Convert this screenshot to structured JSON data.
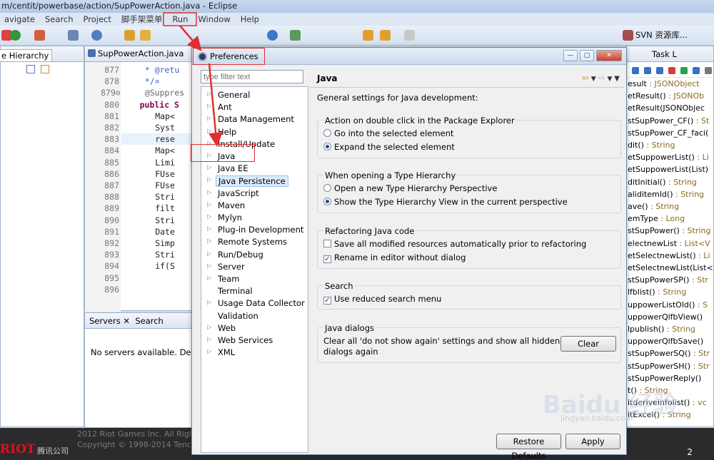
{
  "window": {
    "title": "m/centit/powerbase/action/SupPowerAction.java - Eclipse"
  },
  "menu": [
    "avigate",
    "Search",
    "Project",
    "脚手架菜单",
    "Run",
    "Window",
    "Help"
  ],
  "toolbar": {
    "svn_label": "SVN 资源库..."
  },
  "hierarchy": {
    "tab": "e Hierarchy"
  },
  "editor": {
    "tab": "SupPowerAction.java",
    "lines": [
      {
        "n": "877",
        "code": "* @retu"
      },
      {
        "n": "878",
        "code": "*/¤"
      },
      {
        "n": "879⊖",
        "code": "@Suppres"
      },
      {
        "n": "880",
        "code": "public S"
      },
      {
        "n": "881",
        "code": "Map<"
      },
      {
        "n": "882",
        "code": "Syst"
      },
      {
        "n": "883",
        "code": "rese"
      },
      {
        "n": "884",
        "code": "Map<"
      },
      {
        "n": "885",
        "code": "Limi"
      },
      {
        "n": "886",
        "code": "FUse"
      },
      {
        "n": "887",
        "code": "FUse"
      },
      {
        "n": "888",
        "code": "Stri"
      },
      {
        "n": "889",
        "code": "filt"
      },
      {
        "n": "890",
        "code": "Stri"
      },
      {
        "n": "891",
        "code": "Date"
      },
      {
        "n": "892",
        "code": "Simp"
      },
      {
        "n": "893",
        "code": "Stri"
      },
      {
        "n": "894",
        "code": "if(S"
      },
      {
        "n": "895",
        "code": ""
      },
      {
        "n": "896",
        "code": ""
      }
    ]
  },
  "servers": {
    "tab1": "Servers",
    "tab2": "Search",
    "message": "No servers available. Define"
  },
  "outline": {
    "tab": "Task L",
    "items": [
      {
        "name": "esult",
        "type": " : JSONObject"
      },
      {
        "name": "etResult()",
        "type": " : JSONOb"
      },
      {
        "name": "etResult(JSONObjec",
        "type": ""
      },
      {
        "name": "stSupPower_CF()",
        "type": " : St"
      },
      {
        "name": "stSupPower_CF_faci(",
        "type": ""
      },
      {
        "name": "dit()",
        "type": " : String"
      },
      {
        "name": "etSuppowerList()",
        "type": " : Li"
      },
      {
        "name": "etSuppowerList(List)",
        "type": ""
      },
      {
        "name": "ditInitial()",
        "type": " : String"
      },
      {
        "name": "aliditemId()",
        "type": " : String"
      },
      {
        "name": "ave()",
        "type": " : String"
      },
      {
        "name": "emType",
        "type": " : Long"
      },
      {
        "name": "stSupPower()",
        "type": " : String"
      },
      {
        "name": "electnewList",
        "type": " : List<V"
      },
      {
        "name": "etSelectnewList()",
        "type": " : Li"
      },
      {
        "name": "etSelectnewList(List<",
        "type": ""
      },
      {
        "name": "stSupPowerSP()",
        "type": " : Str"
      },
      {
        "name": "lfblist()",
        "type": " : String"
      },
      {
        "name": "uppowerListOld()",
        "type": " : S"
      },
      {
        "name": "uppowerQlfbView()",
        "type": ""
      },
      {
        "name": "lpublish()",
        "type": " : String"
      },
      {
        "name": "uppowerQlfbSave()",
        "type": ""
      },
      {
        "name": "stSupPowerSQ()",
        "type": " : Str"
      },
      {
        "name": "stSupPowerSH()",
        "type": " : Str"
      },
      {
        "name": "stSupPowerReply()",
        "type": ""
      },
      {
        "name": "t()",
        "type": " : String"
      },
      {
        "name": "itderiveinfolist()",
        "type": " : vc"
      },
      {
        "name": "itExcel()",
        "type": " : String"
      }
    ]
  },
  "footer": {
    "line1": "2012 Riot Games Inc. All Rights",
    "line2": "Copyright © 1998-2014 Tencent",
    "logo": "RIOT",
    "company": "腾讯公司",
    "page": "2"
  },
  "dialog": {
    "title": "Preferences",
    "filter_placeholder": "type filter text",
    "tree": [
      {
        "label": "General",
        "arrow": true
      },
      {
        "label": "Ant",
        "arrow": true
      },
      {
        "label": "Data Management",
        "arrow": true
      },
      {
        "label": "Help",
        "arrow": true
      },
      {
        "label": "Install/Update",
        "arrow": true
      },
      {
        "label": "Java",
        "arrow": true
      },
      {
        "label": "Java EE",
        "arrow": true
      },
      {
        "label": "Java Persistence",
        "arrow": true
      },
      {
        "label": "JavaScript",
        "arrow": true
      },
      {
        "label": "Maven",
        "arrow": true
      },
      {
        "label": "Mylyn",
        "arrow": true
      },
      {
        "label": "Plug-in Development",
        "arrow": true
      },
      {
        "label": "Remote Systems",
        "arrow": true
      },
      {
        "label": "Run/Debug",
        "arrow": true
      },
      {
        "label": "Server",
        "arrow": true
      },
      {
        "label": "Team",
        "arrow": true
      },
      {
        "label": "Terminal",
        "arrow": false
      },
      {
        "label": "Usage Data Collector",
        "arrow": true
      },
      {
        "label": "Validation",
        "arrow": false
      },
      {
        "label": "Web",
        "arrow": true
      },
      {
        "label": "Web Services",
        "arrow": true
      },
      {
        "label": "XML",
        "arrow": true
      }
    ],
    "page": {
      "title": "Java",
      "description": "General settings for Java development:",
      "group1": {
        "label": "Action on double click in the Package Explorer",
        "opt1": "Go into the selected element",
        "opt2": "Expand the selected element"
      },
      "group2": {
        "label": "When opening a Type Hierarchy",
        "opt1": "Open a new Type Hierarchy Perspective",
        "opt2": "Show the Type Hierarchy View in the current perspective"
      },
      "group3": {
        "label": "Refactoring Java code",
        "opt1": "Save all modified resources automatically prior to refactoring",
        "opt2": "Rename in editor without dialog"
      },
      "group4": {
        "label": "Search",
        "opt1": "Use reduced search menu"
      },
      "group5": {
        "label": "Java dialogs",
        "text1": "Clear all 'do not show again' settings and show all hidden",
        "text2": "dialogs again",
        "button": "Clear"
      }
    },
    "restore_button": "Restore Defaults",
    "apply_button": "Apply"
  },
  "watermark": {
    "text": "Baidu 经验",
    "url": "jingyan.baidu.com"
  }
}
